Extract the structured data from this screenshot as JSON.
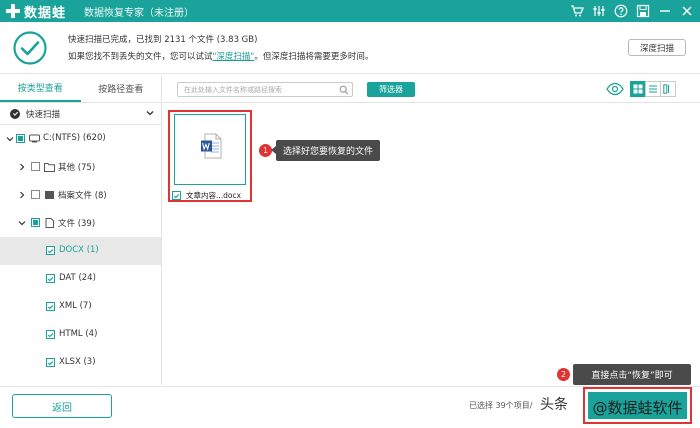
{
  "titlebar": {
    "logo_text": "数据蛙",
    "app_title": "数据恢复专家（未注册）",
    "controls": [
      "cart-icon",
      "settings-icon",
      "help-icon",
      "save-icon",
      "minimize-icon",
      "close-icon"
    ]
  },
  "status": {
    "line1": "快速扫描已完成，已找到 2131 个文件 (3.83 GB)",
    "line2_prefix": "如果您找不到丢失的文件，您可以试试",
    "line2_link": "\"深度扫描\"",
    "line2_suffix": "。但深度扫描将需要更多时间。",
    "deep_scan_button": "深度扫描"
  },
  "sidebar": {
    "tabs": [
      {
        "label": "按类型查看",
        "active": true
      },
      {
        "label": "按路径查看",
        "active": false
      }
    ],
    "quick_scan_label": "快速扫描",
    "tree": [
      {
        "label": "C:(NTFS) (620)"
      },
      {
        "label": "其他 (75)"
      },
      {
        "label": "档案文件 (8)"
      },
      {
        "label": "文件 (39)"
      },
      {
        "label": "DOCX (1)"
      },
      {
        "label": "DAT (24)"
      },
      {
        "label": "XML (7)"
      },
      {
        "label": "HTML (4)"
      },
      {
        "label": "XLSX (3)"
      }
    ]
  },
  "toolbar": {
    "search_placeholder": "在此处输入文件名称或路径搜索",
    "filter_button": "筛选器"
  },
  "files": [
    {
      "name": "文章内容...docx",
      "checked": true
    }
  ],
  "callouts": {
    "step1_num": "1",
    "step1_text": "选择好您要恢复的文件",
    "step2_num": "2",
    "step2_text": "直接点击“恢复”即可"
  },
  "bottom": {
    "back_button": "返回",
    "selected_text": "已选择 39个项目/",
    "watermark_prefix": "头条",
    "recover_text": "@数据蛙软件"
  },
  "colors": {
    "accent": "#1aa39a",
    "highlight_red": "#e03434",
    "callout_bg": "#4a4a4a"
  }
}
